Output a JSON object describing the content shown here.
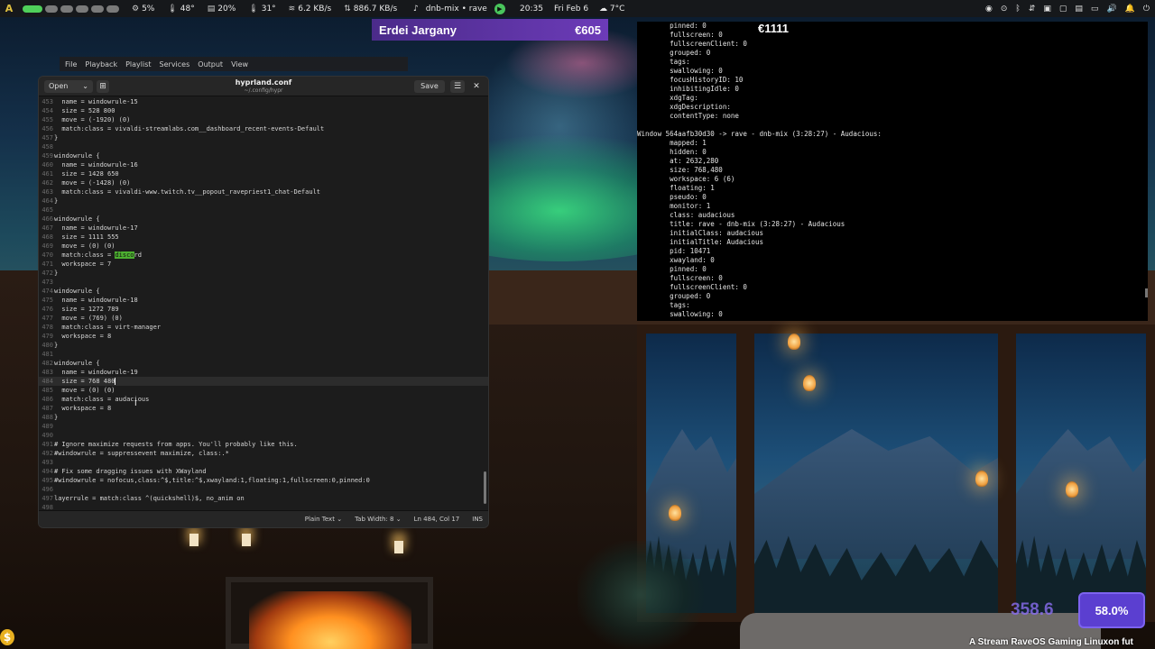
{
  "topbar": {
    "logo_icon": "arch-logo-icon",
    "stats": [
      {
        "icon": "cpu-icon",
        "glyph": "⚙",
        "value": "5%"
      },
      {
        "icon": "temperature-icon",
        "glyph": "🌡",
        "value": "48°"
      },
      {
        "icon": "memory-icon",
        "glyph": "▤",
        "value": "20%"
      },
      {
        "icon": "gpu-temp-icon",
        "glyph": "🌡",
        "value": "31°"
      },
      {
        "icon": "wifi-icon",
        "glyph": "≋",
        "value": "6.2 KB/s"
      },
      {
        "icon": "download-icon",
        "glyph": "⇅",
        "value": "886.7 KB/s"
      }
    ],
    "media_title": "dnb-mix • rave",
    "clock": "20:35",
    "date": "Fri Feb 6",
    "weather": "7°C"
  },
  "donation": {
    "name": "Erdei Jargany",
    "amount": "€605"
  },
  "player_menu": [
    "File",
    "Playback",
    "Playlist",
    "Services",
    "Output",
    "View"
  ],
  "editor": {
    "open_label": "Open",
    "title": "hyprland.conf",
    "path": "~/.config/hypr",
    "save_label": "Save",
    "status": {
      "syntax": "Plain Text",
      "tab_width": "Tab Width: 8",
      "position": "Ln 484, Col 17",
      "mode": "INS"
    },
    "lines": [
      {
        "n": "453",
        "t": "  name = windowrule-15"
      },
      {
        "n": "454",
        "t": "  size = 528 800"
      },
      {
        "n": "455",
        "t": "  move = (-1920) (0)"
      },
      {
        "n": "456",
        "t": "  match:class = vivaldi-streamlabs.com__dashboard_recent-events-Default"
      },
      {
        "n": "457",
        "t": "}"
      },
      {
        "n": "458",
        "t": ""
      },
      {
        "n": "459",
        "t": "windowrule {"
      },
      {
        "n": "460",
        "t": "  name = windowrule-16"
      },
      {
        "n": "461",
        "t": "  size = 1428 650"
      },
      {
        "n": "462",
        "t": "  move = (-1428) (0)"
      },
      {
        "n": "463",
        "t": "  match:class = vivaldi-www.twitch.tv__popout_ravepriest1_chat-Default"
      },
      {
        "n": "464",
        "t": "}"
      },
      {
        "n": "465",
        "t": ""
      },
      {
        "n": "466",
        "t": "windowrule {"
      },
      {
        "n": "467",
        "t": "  name = windowrule-17"
      },
      {
        "n": "468",
        "t": "  size = 1111 555"
      },
      {
        "n": "469",
        "t": "  move = (0) (0)"
      },
      {
        "n": "470",
        "t": "  match:class = ",
        "hl": "disco",
        "rest": "rd"
      },
      {
        "n": "471",
        "t": "  workspace = 7"
      },
      {
        "n": "472",
        "t": "}"
      },
      {
        "n": "473",
        "t": ""
      },
      {
        "n": "474",
        "t": "windowrule {"
      },
      {
        "n": "475",
        "t": "  name = windowrule-18"
      },
      {
        "n": "476",
        "t": "  size = 1272 789"
      },
      {
        "n": "477",
        "t": "  move = (769) (0)"
      },
      {
        "n": "478",
        "t": "  match:class = virt-manager"
      },
      {
        "n": "479",
        "t": "  workspace = 8"
      },
      {
        "n": "480",
        "t": "}"
      },
      {
        "n": "481",
        "t": ""
      },
      {
        "n": "482",
        "t": "windowrule {"
      },
      {
        "n": "483",
        "t": "  name = windowrule-19"
      },
      {
        "n": "484",
        "t": "  size = 768 480",
        "cur": true
      },
      {
        "n": "485",
        "t": "  move = (0) (0)"
      },
      {
        "n": "486",
        "t": "  match:class = audacious"
      },
      {
        "n": "487",
        "t": "  workspace = 8"
      },
      {
        "n": "488",
        "t": "}"
      },
      {
        "n": "489",
        "t": ""
      },
      {
        "n": "490",
        "t": ""
      },
      {
        "n": "491",
        "t": "# Ignore maximize requests from apps. You'll probably like this."
      },
      {
        "n": "492",
        "t": "#windowrule = suppressevent maximize, class:.*"
      },
      {
        "n": "493",
        "t": ""
      },
      {
        "n": "494",
        "t": "# Fix some dragging issues with XWayland"
      },
      {
        "n": "495",
        "t": "#windowrule = nofocus,class:^$,title:^$,xwayland:1,floating:1,fullscreen:0,pinned:0"
      },
      {
        "n": "496",
        "t": ""
      },
      {
        "n": "497",
        "t": "layerrule = match:class ^(quickshell)$, no_anim on"
      },
      {
        "n": "498",
        "t": ""
      }
    ]
  },
  "terminal": {
    "big_text": "€1111",
    "lines": [
      "        pinned: 0",
      "        fullscreen: 0",
      "        fullscreenClient: 0",
      "        grouped: 0",
      "        tags:",
      "        swallowing: 0",
      "        focusHistoryID: 10",
      "        inhibitingIdle: 0",
      "        xdgTag:",
      "        xdgDescription:",
      "        contentType: none",
      "",
      "Window 564aafb30d30 -> rave - dnb-mix (3:28:27) - Audacious:",
      "        mapped: 1",
      "        hidden: 0",
      "        at: 2632,280",
      "        size: 768,480",
      "        workspace: 6 (6)",
      "        floating: 1",
      "        pseudo: 0",
      "        monitor: 1",
      "        class: audacious",
      "        title: rave - dnb-mix (3:28:27) - Audacious",
      "        initialClass: audacious",
      "        initialTitle: Audacious",
      "        pid: 10471",
      "        xwayland: 0",
      "        pinned: 0",
      "        fullscreen: 0",
      "        fullscreenClient: 0",
      "        grouped: 0",
      "        tags:",
      "        swallowing: 0"
    ]
  },
  "overlay": {
    "gauge_value": "358.6",
    "percent": "58.0%",
    "ticker": "A Stream RaveOS Gaming Linuxon fut"
  }
}
